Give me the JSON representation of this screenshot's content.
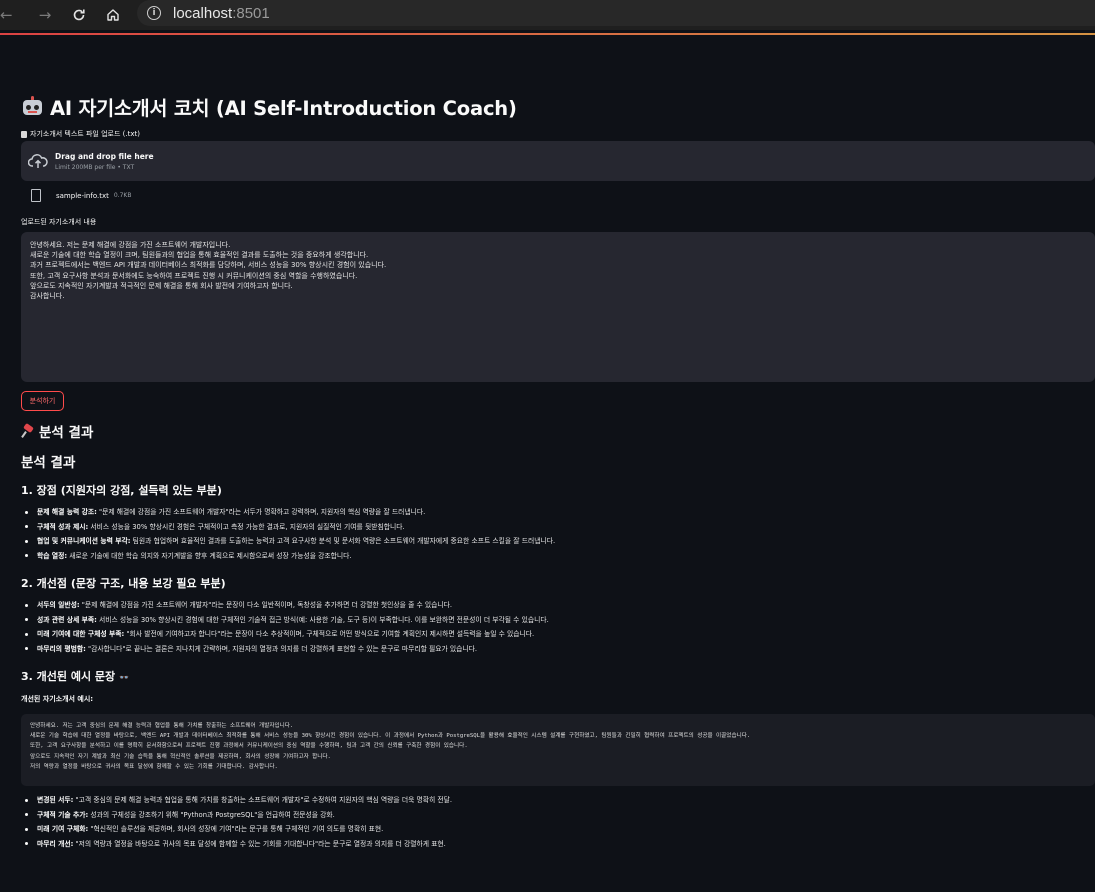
{
  "browser": {
    "url_host": "localhost",
    "url_port": ":8501"
  },
  "app": {
    "title": "AI 자기소개서 코치 (AI Self-Introduction Coach)",
    "upload_label": "자기소개서 텍스트 파일 업로드 (.txt)",
    "dropzone_text": "Drag and drop file here",
    "dropzone_limit": "Limit 200MB per file • TXT",
    "file_name": "sample-info.txt",
    "file_size": "0.7KB",
    "content_label": "업로드된 자기소개서 내용",
    "content_text": "안녕하세요. 저는 문제 해결에 강점을 가진 소프트웨어 개발자입니다.\n새로운 기술에 대한 학습 열정이 크며, 팀원들과의 협업을 통해 효율적인 결과를 도출하는 것을 중요하게 생각합니다.\n과거 프로젝트에서는 백엔드 API 개발과 데이터베이스 최적화를 담당하며, 서비스 성능을 30% 향상시킨 경험이 있습니다.\n또한, 고객 요구사항 분석과 문서화에도 능숙하여 프로젝트 진행 시 커뮤니케이션의 중심 역할을 수행하였습니다.\n앞으로도 지속적인 자기계발과 적극적인 문제 해결을 통해 회사 발전에 기여하고자 합니다.\n감사합니다.",
    "analyze_button": "분석하기"
  },
  "results": {
    "heading": "분석 결과",
    "subheading": "분석 결과",
    "section1_title": "1. 장점 (지원자의 강점, 설득력 있는 부분)",
    "section1_items": [
      {
        "bold": "문제 해결 능력 강조:",
        "text": " \"문제 해결에 강점을 가진 소프트웨어 개발자\"라는 서두가 명확하고 강력하며, 지원자의 핵심 역량을 잘 드러냅니다."
      },
      {
        "bold": "구체적 성과 제시:",
        "text": " 서비스 성능을 30% 향상시킨 경험은 구체적이고 측정 가능한 결과로, 지원자의 실질적인 기여를 뒷받침합니다."
      },
      {
        "bold": "협업 및 커뮤니케이션 능력 부각:",
        "text": " 팀원과 협업하며 효율적인 결과를 도출하는 능력과 고객 요구사항 분석 및 문서화 역량은 소프트웨어 개발자에게 중요한 소프트 스킬을 잘 드러냅니다."
      },
      {
        "bold": "학습 열정:",
        "text": " 새로운 기술에 대한 학습 의지와 자기계발을 향후 계획으로 제시함으로써 성장 가능성을 강조합니다."
      }
    ],
    "section2_title": "2. 개선점 (문장 구조, 내용 보강 필요 부분)",
    "section2_items": [
      {
        "bold": "서두의 일반성:",
        "text": " \"문제 해결에 강점을 가진 소프트웨어 개발자\"라는 문장이 다소 일반적이며, 독창성을 추가하면 더 강렬한 첫인상을 줄 수 있습니다."
      },
      {
        "bold": "성과 관련 상세 부족:",
        "text": " 서비스 성능을 30% 향상시킨 경험에 대한 구체적인 기술적 접근 방식(예: 사용한 기술, 도구 등)이 부족합니다. 이를 보완하면 전문성이 더 부각될 수 있습니다."
      },
      {
        "bold": "미래 기여에 대한 구체성 부족:",
        "text": " \"회사 발전에 기여하고자 합니다\"라는 문장이 다소 추상적이며, 구체적으로 어떤 방식으로 기여할 계획인지 제시하면 설득력을 높일 수 있습니다."
      },
      {
        "bold": "마무리의 평범함:",
        "text": " \"감사합니다\"로 끝나는 결론은 지나치게 간략하며, 지원자의 열정과 의지를 더 강렬하게 표현할 수 있는 문구로 마무리할 필요가 있습니다."
      }
    ],
    "section3_title": "3. 개선된 예시 문장",
    "section3_glyph": "👓",
    "example_label": "개선된 자기소개서 예시:",
    "example_text": "안녕하세요. 저는 고객 중심의 문제 해결 능력과 협업을 통해 가치를 창출하는 소프트웨어 개발자입니다.\n새로운 기술 학습에 대한 열정을 바탕으로, 백엔드 API 개발과 데이터베이스 최적화를 통해 서비스 성능을 30% 향상시킨 경험이 있습니다. 이 과정에서 Python과 PostgreSQL을 활용해 효율적인 시스템 설계를 구현하였고, 팀원들과 긴밀히 협력하여 프로젝트의 성공을 이끌었습니다.\n또한, 고객 요구사항을 분석하고 이를 명확히 문서화함으로써 프로젝트 진행 과정에서 커뮤니케이션의 중심 역할을 수행하며, 팀과 고객 간의 신뢰를 구축한 경험이 있습니다.\n앞으로도 지속적인 자기 계발과 최신 기술 습득을 통해 혁신적인 솔루션을 제공하며, 회사의 성장에 기여하고자 합니다.\n저의 역량과 열정을 바탕으로 귀사의 목표 달성에 함께할 수 있는 기회를 기대합니다. 감사합니다.",
    "summary_items": [
      {
        "bold": "변경된 서두:",
        "text": " \"고객 중심의 문제 해결 능력과 협업을 통해 가치를 창출하는 소프트웨어 개발자\"로 수정하여 지원자의 핵심 역량을 더욱 명확히 전달."
      },
      {
        "bold": "구체적 기술 추가:",
        "text": " 성과의 구체성을 강조하기 위해 \"Python과 PostgreSQL\"을 언급하여 전문성을 강화."
      },
      {
        "bold": "미래 기여 구체화:",
        "text": " \"혁신적인 솔루션을 제공하며, 회사의 성장에 기여\"라는 문구를 통해 구체적인 기여 의도를 명확히 표현."
      },
      {
        "bold": "마무리 개선:",
        "text": " \"저의 역량과 열정을 바탕으로 귀사의 목표 달성에 함께할 수 있는 기회를 기대합니다\"라는 문구로 열정과 의지를 더 강렬하게 표현."
      }
    ]
  },
  "icons": {
    "back": "back-arrow-icon",
    "forward": "forward-arrow-icon",
    "reload": "reload-icon",
    "home": "home-icon",
    "site_info": "site-info-icon",
    "upload": "cloud-upload-icon",
    "file": "file-icon",
    "robot": "robot-icon",
    "pin": "pushpin-icon",
    "doc": "document-icon"
  },
  "colors": {
    "background": "#0e1117",
    "panel": "#262730",
    "accent": "#ff4b4b"
  }
}
